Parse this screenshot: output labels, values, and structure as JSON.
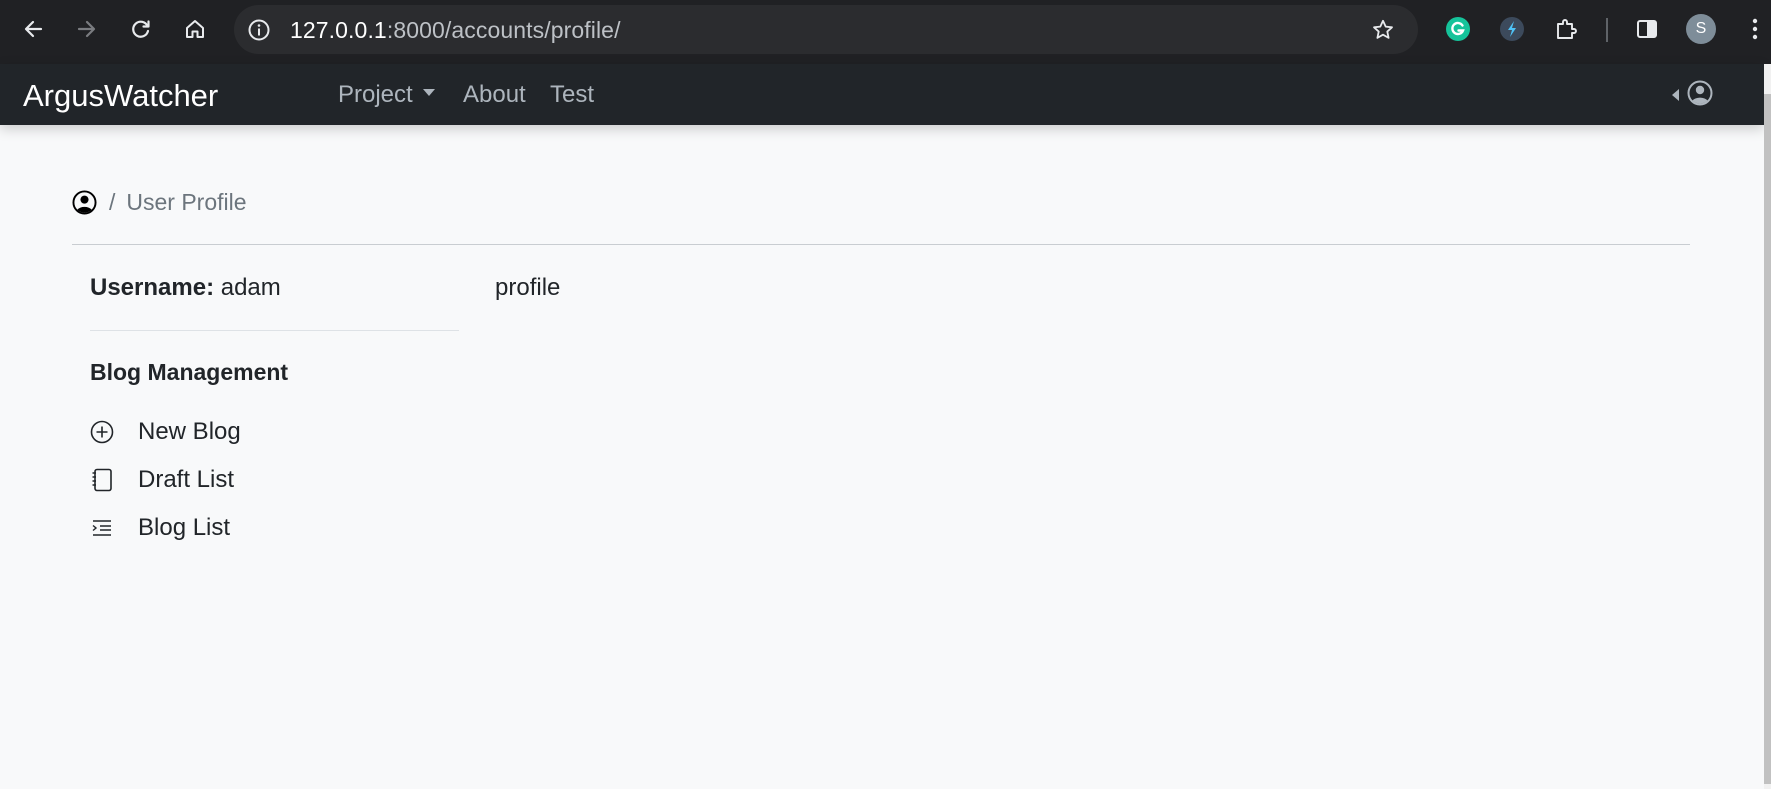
{
  "browser": {
    "url_host": "127.0.0.1",
    "url_path": ":8000/accounts/profile/",
    "profile_initial": "S",
    "extensions": [
      "grammarly-icon",
      "lightning-extension-icon",
      "puzzle-icon"
    ]
  },
  "navbar": {
    "brand": "ArgusWatcher",
    "links": {
      "project": "Project",
      "about": "About",
      "test": "Test"
    }
  },
  "breadcrumb": {
    "separator": "/",
    "current": "User Profile"
  },
  "sidebar": {
    "username_label": "Username:",
    "username_value": "adam",
    "section_title": "Blog Management",
    "items": [
      {
        "label": "New Blog",
        "icon": "plus-circle-icon"
      },
      {
        "label": "Draft List",
        "icon": "journal-icon"
      },
      {
        "label": "Blog List",
        "icon": "list-indent-icon"
      }
    ]
  },
  "main": {
    "text": "profile"
  },
  "colors": {
    "navbar_bg": "#212529",
    "page_bg": "#f8f9fa",
    "chrome_bg": "#202124"
  }
}
